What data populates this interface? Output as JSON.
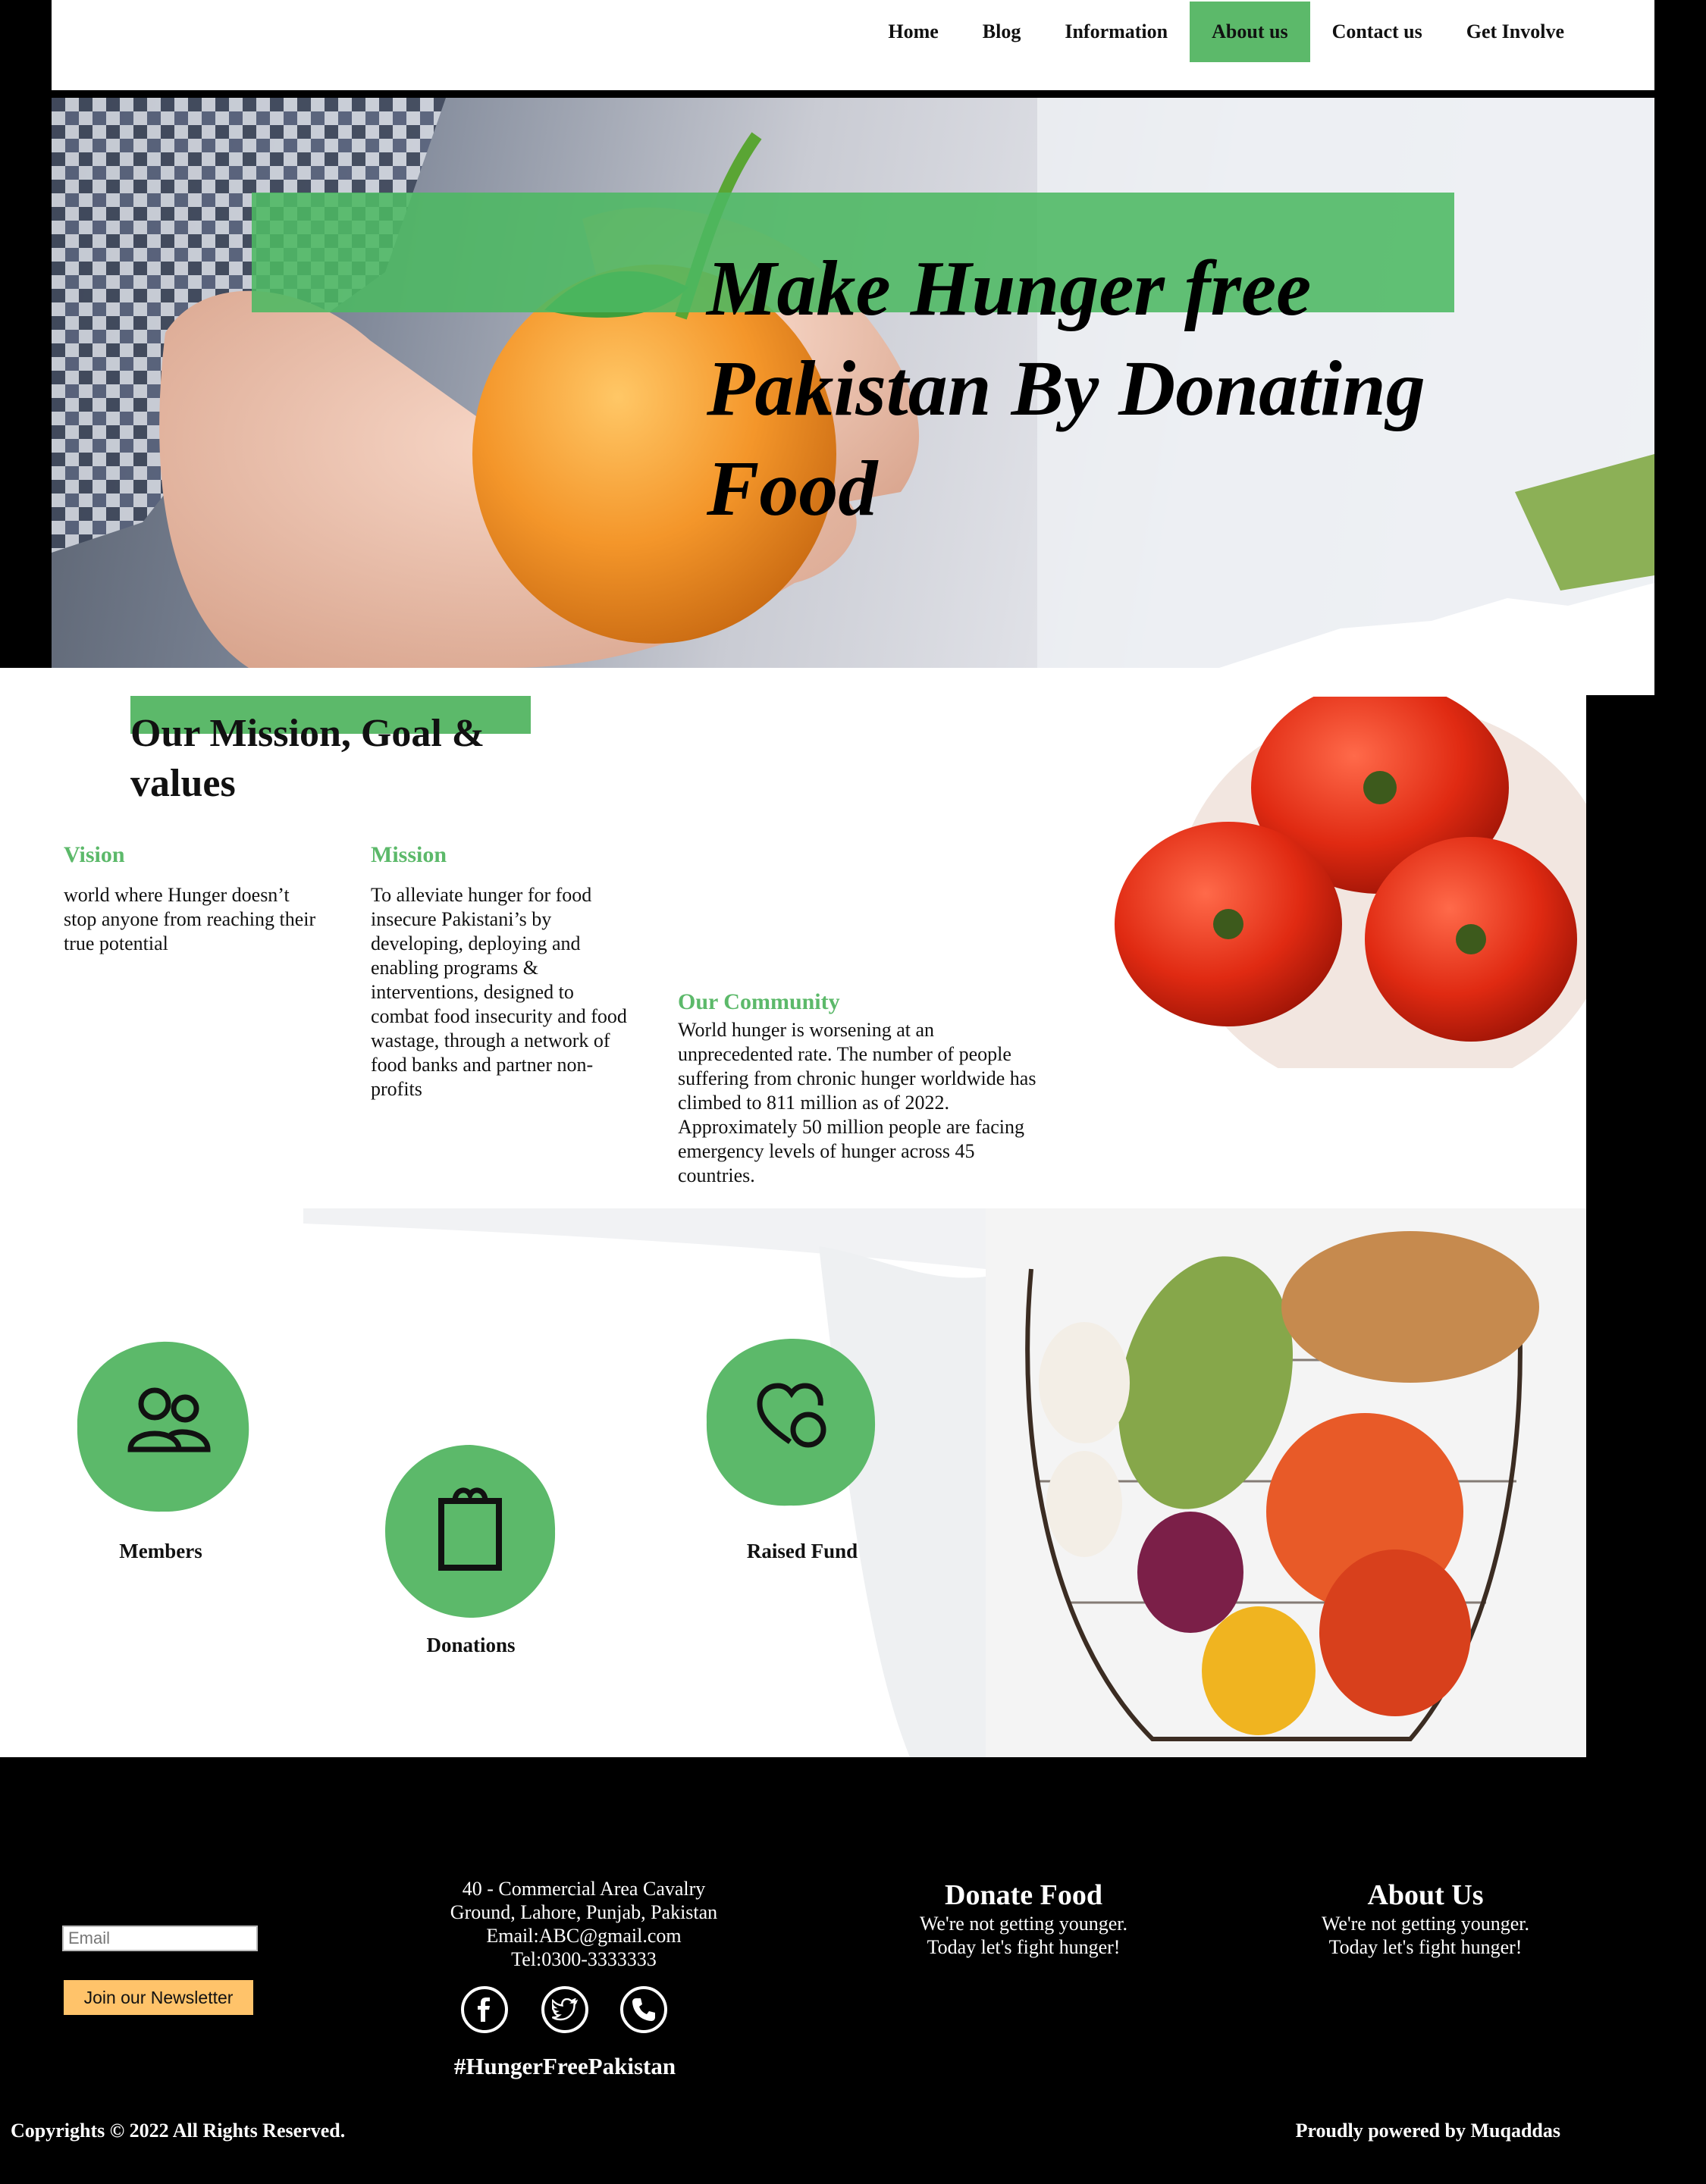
{
  "nav": {
    "items": [
      "Home",
      "Blog",
      "Information",
      "About us",
      "Contact us",
      "Get Involve"
    ],
    "active": "About us"
  },
  "hero": {
    "title": "Make Hunger free Pakistan By Donating Food"
  },
  "mission": {
    "title": "Our Mission, Goal & values",
    "vision": {
      "heading": "Vision",
      "text": "world where Hunger doesn’t stop anyone from reaching their true potential"
    },
    "mission": {
      "heading": "Mission",
      "text": "To alleviate hunger for food insecure Pakistani’s by developing, deploying and enabling programs & interventions, designed to combat food insecurity and food wastage, through a network of food banks and partner non-profits"
    },
    "community": {
      "heading": "Our Community",
      "text": "World hunger is worsening at an unprecedented rate. The number of people suffering from chronic hunger worldwide has climbed to 811 million as of 2022. Approximately 50 million people are facing emergency levels of hunger across 45 countries."
    }
  },
  "stats": {
    "members": "Members",
    "donations": "Donations",
    "raised": "Raised Fund",
    "icons": [
      "people-icon",
      "shopping-bag-icon",
      "heart-coin-icon"
    ]
  },
  "footer": {
    "email_placeholder": "Email",
    "newsletter_button": "Join our Newsletter",
    "address_line1": "40 - Commercial Area Cavalry",
    "address_line2": "Ground, Lahore, Punjab, Pakistan",
    "email": "Email:ABC@gmail.com",
    "tel": "Tel:0300-3333333",
    "social_icons": [
      "facebook-icon",
      "twitter-icon",
      "phone-icon"
    ],
    "hashtag": "#HungerFreePakistan",
    "donate": {
      "title": "Donate Food",
      "line1": "We're not getting younger.",
      "line2": "Today let's fight hunger!"
    },
    "about": {
      "title": "About Us",
      "line1": "We're not getting younger.",
      "line2": "Today let's fight hunger!"
    },
    "copyright": "Copyrights © 2022 All Rights Reserved.",
    "powered": "Proudly powered by Muqaddas"
  },
  "colors": {
    "accent_green": "#5cb96a",
    "newsletter_yellow": "#ffc36a",
    "background": "#000000"
  }
}
